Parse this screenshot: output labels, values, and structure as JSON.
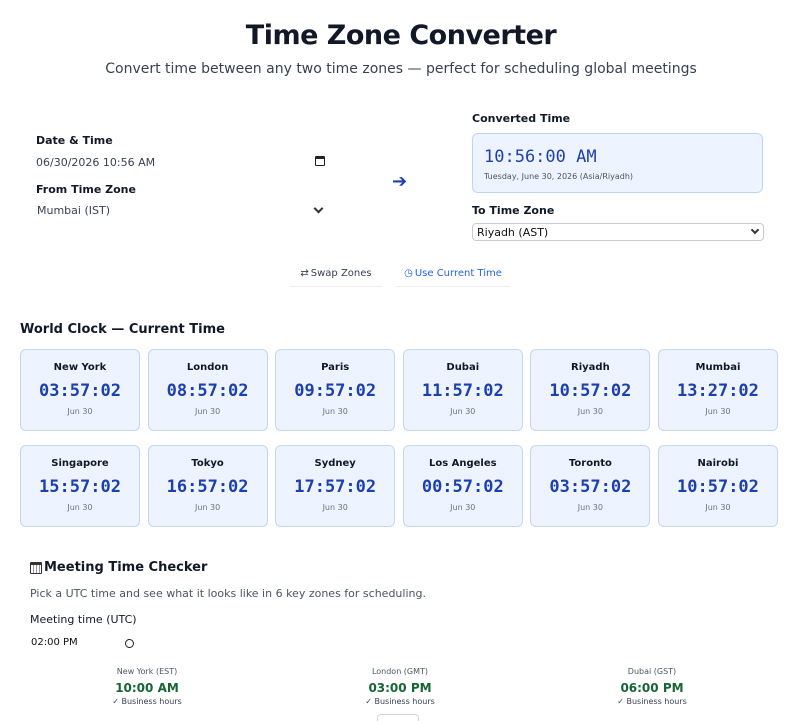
{
  "header": {
    "title": "Time Zone Converter",
    "subtitle": "Convert time between any two time zones — perfect for scheduling global meetings"
  },
  "converter": {
    "datetime_label": "Date & Time",
    "datetime_value": "06/30/2026 10:56 AM",
    "from_label": "From Time Zone",
    "from_value": "Mumbai (IST)",
    "converted_label": "Converted Time",
    "converted_time": "10:56:00 AM",
    "converted_date": "Tuesday, June 30, 2026 (Asia/Riyadh)",
    "to_label": "To Time Zone",
    "to_value": "Riyadh (AST)",
    "swap_label": "Swap Zones",
    "swap_icon": "⇄",
    "now_label": "Use Current Time",
    "now_icon": "◷"
  },
  "world_clock": {
    "title": "World Clock — Current Time",
    "clocks": [
      {
        "city": "New York",
        "time": "03:57:02",
        "date": "Jun 30"
      },
      {
        "city": "London",
        "time": "08:57:02",
        "date": "Jun 30"
      },
      {
        "city": "Paris",
        "time": "09:57:02",
        "date": "Jun 30"
      },
      {
        "city": "Dubai",
        "time": "11:57:02",
        "date": "Jun 30"
      },
      {
        "city": "Riyadh",
        "time": "10:57:02",
        "date": "Jun 30"
      },
      {
        "city": "Mumbai",
        "time": "13:27:02",
        "date": "Jun 30"
      },
      {
        "city": "Singapore",
        "time": "15:57:02",
        "date": "Jun 30"
      },
      {
        "city": "Tokyo",
        "time": "16:57:02",
        "date": "Jun 30"
      },
      {
        "city": "Sydney",
        "time": "17:57:02",
        "date": "Jun 30"
      },
      {
        "city": "Los Angeles",
        "time": "00:57:02",
        "date": "Jun 30"
      },
      {
        "city": "Toronto",
        "time": "03:57:02",
        "date": "Jun 30"
      },
      {
        "city": "Nairobi",
        "time": "10:57:02",
        "date": "Jun 30"
      }
    ]
  },
  "meeting": {
    "title": "Meeting Time Checker",
    "description": "Pick a UTC time and see what it looks like in 6 key zones for scheduling.",
    "input_label": "Meeting time (UTC)",
    "input_value": "02:00 PM",
    "zones": [
      {
        "name": "New York (EST)",
        "time": "10:00 AM",
        "status": "✓ Business hours"
      },
      {
        "name": "London (GMT)",
        "time": "03:00 PM",
        "status": "✓ Business hours"
      },
      {
        "name": "Dubai (GST)",
        "time": "06:00 PM",
        "status": "✓ Business hours"
      }
    ]
  },
  "colors": {
    "accent": "#1e40af",
    "link": "#2563eb",
    "card_bg": "#eef4ff",
    "business_green": "#166534"
  }
}
